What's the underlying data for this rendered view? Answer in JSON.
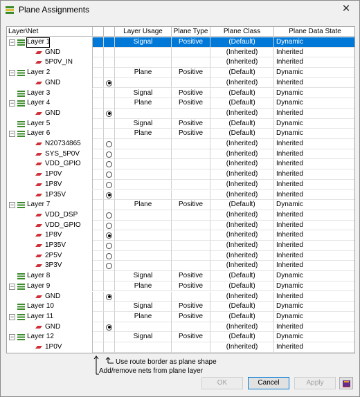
{
  "window": {
    "title": "Plane Assignments",
    "close_glyph": "✕"
  },
  "columns": {
    "layer_net": "Layer\\Net",
    "layer_usage": "Layer Usage",
    "plane_type": "Plane Type",
    "plane_class": "Plane Class",
    "plane_data_state": "Plane Data State"
  },
  "rows": [
    {
      "kind": "layer",
      "name": "Layer 1",
      "usage": "Signal",
      "type": "Positive",
      "class": "(Default)",
      "state": "Dynamic",
      "selected": true,
      "radio": "none"
    },
    {
      "kind": "net",
      "name": "GND",
      "usage": "",
      "type": "",
      "class": "(Inherited)",
      "state": "Inherited",
      "radio": "none"
    },
    {
      "kind": "net",
      "name": "5P0V_IN",
      "usage": "",
      "type": "",
      "class": "(Inherited)",
      "state": "Inherited",
      "radio": "none"
    },
    {
      "kind": "layer",
      "name": "Layer 2",
      "usage": "Plane",
      "type": "Positive",
      "class": "(Default)",
      "state": "Dynamic",
      "radio": "none"
    },
    {
      "kind": "net",
      "name": "GND",
      "usage": "",
      "type": "",
      "class": "(Inherited)",
      "state": "Inherited",
      "radio": "on"
    },
    {
      "kind": "layer",
      "name": "Layer 3",
      "usage": "Signal",
      "type": "Positive",
      "class": "(Default)",
      "state": "Dynamic",
      "radio": "none",
      "noexp": true
    },
    {
      "kind": "layer",
      "name": "Layer 4",
      "usage": "Plane",
      "type": "Positive",
      "class": "(Default)",
      "state": "Dynamic",
      "radio": "none"
    },
    {
      "kind": "net",
      "name": "GND",
      "usage": "",
      "type": "",
      "class": "(Inherited)",
      "state": "Inherited",
      "radio": "on"
    },
    {
      "kind": "layer",
      "name": "Layer 5",
      "usage": "Signal",
      "type": "Positive",
      "class": "(Default)",
      "state": "Dynamic",
      "radio": "none",
      "noexp": true
    },
    {
      "kind": "layer",
      "name": "Layer 6",
      "usage": "Plane",
      "type": "Positive",
      "class": "(Default)",
      "state": "Dynamic",
      "radio": "none"
    },
    {
      "kind": "net",
      "name": "N20734865",
      "usage": "",
      "type": "",
      "class": "(Inherited)",
      "state": "Inherited",
      "radio": "off"
    },
    {
      "kind": "net",
      "name": "SYS_5P0V",
      "usage": "",
      "type": "",
      "class": "(Inherited)",
      "state": "Inherited",
      "radio": "off"
    },
    {
      "kind": "net",
      "name": "VDD_GPIO",
      "usage": "",
      "type": "",
      "class": "(Inherited)",
      "state": "Inherited",
      "radio": "off"
    },
    {
      "kind": "net",
      "name": "1P0V",
      "usage": "",
      "type": "",
      "class": "(Inherited)",
      "state": "Inherited",
      "radio": "off"
    },
    {
      "kind": "net",
      "name": "1P8V",
      "usage": "",
      "type": "",
      "class": "(Inherited)",
      "state": "Inherited",
      "radio": "off"
    },
    {
      "kind": "net",
      "name": "1P35V",
      "usage": "",
      "type": "",
      "class": "(Inherited)",
      "state": "Inherited",
      "radio": "on"
    },
    {
      "kind": "layer",
      "name": "Layer 7",
      "usage": "Plane",
      "type": "Positive",
      "class": "(Default)",
      "state": "Dynamic",
      "radio": "none"
    },
    {
      "kind": "net",
      "name": "VDD_DSP",
      "usage": "",
      "type": "",
      "class": "(Inherited)",
      "state": "Inherited",
      "radio": "off"
    },
    {
      "kind": "net",
      "name": "VDD_GPIO",
      "usage": "",
      "type": "",
      "class": "(Inherited)",
      "state": "Inherited",
      "radio": "off"
    },
    {
      "kind": "net",
      "name": "1P8V",
      "usage": "",
      "type": "",
      "class": "(Inherited)",
      "state": "Inherited",
      "radio": "on"
    },
    {
      "kind": "net",
      "name": "1P35V",
      "usage": "",
      "type": "",
      "class": "(Inherited)",
      "state": "Inherited",
      "radio": "off"
    },
    {
      "kind": "net",
      "name": "2P5V",
      "usage": "",
      "type": "",
      "class": "(Inherited)",
      "state": "Inherited",
      "radio": "off"
    },
    {
      "kind": "net",
      "name": "3P3V",
      "usage": "",
      "type": "",
      "class": "(Inherited)",
      "state": "Inherited",
      "radio": "off"
    },
    {
      "kind": "layer",
      "name": "Layer 8",
      "usage": "Signal",
      "type": "Positive",
      "class": "(Default)",
      "state": "Dynamic",
      "radio": "none",
      "noexp": true
    },
    {
      "kind": "layer",
      "name": "Layer 9",
      "usage": "Plane",
      "type": "Positive",
      "class": "(Default)",
      "state": "Dynamic",
      "radio": "none"
    },
    {
      "kind": "net",
      "name": "GND",
      "usage": "",
      "type": "",
      "class": "(Inherited)",
      "state": "Inherited",
      "radio": "on"
    },
    {
      "kind": "layer",
      "name": "Layer 10",
      "usage": "Signal",
      "type": "Positive",
      "class": "(Default)",
      "state": "Dynamic",
      "radio": "none",
      "noexp": true
    },
    {
      "kind": "layer",
      "name": "Layer 11",
      "usage": "Plane",
      "type": "Positive",
      "class": "(Default)",
      "state": "Dynamic",
      "radio": "none"
    },
    {
      "kind": "net",
      "name": "GND",
      "usage": "",
      "type": "",
      "class": "(Inherited)",
      "state": "Inherited",
      "radio": "on"
    },
    {
      "kind": "layer",
      "name": "Layer 12",
      "usage": "Signal",
      "type": "Positive",
      "class": "(Default)",
      "state": "Dynamic",
      "radio": "none"
    },
    {
      "kind": "net",
      "name": "1P0V",
      "usage": "",
      "type": "",
      "class": "(Inherited)",
      "state": "Inherited",
      "radio": "none"
    }
  ],
  "legend": {
    "route_border": "Use route border as plane shape",
    "add_remove": "Add/remove nets from plane layer"
  },
  "buttons": {
    "ok": "OK",
    "cancel": "Cancel",
    "apply": "Apply"
  },
  "icons": {
    "app": "plane-assignments-icon",
    "layer": "layer-stack-icon",
    "net": "net-icon",
    "help": "help-book-icon"
  },
  "colors": {
    "selection": "#0078d7",
    "net_icon": "#d0303a",
    "layer_icon": "#3a8a2a"
  }
}
